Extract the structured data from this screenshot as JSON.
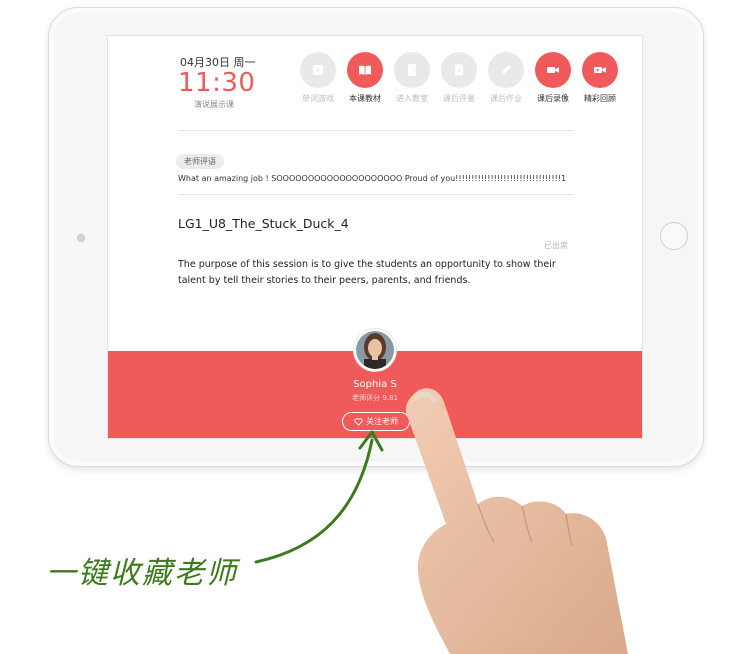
{
  "header": {
    "date": "04月30日 周一",
    "time": "11:30",
    "subtitle": "演说展示课"
  },
  "toolbar": [
    {
      "label": "单词游戏",
      "active": false,
      "icon": "game-icon"
    },
    {
      "label": "本课教材",
      "active": true,
      "icon": "book-icon"
    },
    {
      "label": "进入教室",
      "active": false,
      "icon": "door-icon"
    },
    {
      "label": "课后评量",
      "active": false,
      "icon": "checklist-icon"
    },
    {
      "label": "课后作业",
      "active": false,
      "icon": "pencil-icon"
    },
    {
      "label": "课后录像",
      "active": true,
      "icon": "video-icon"
    },
    {
      "label": "精彩回顾",
      "active": true,
      "icon": "replay-video-icon"
    }
  ],
  "evaluation": {
    "tag": "老师评语",
    "text": "What an amazing job ! SOOOOOOOOOOOOOOOOOOOO Proud of you!!!!!!!!!!!!!!!!!!!!!!!!!!!!!!!!!1"
  },
  "lesson": {
    "title": "LG1_U8_The_Stuck_Duck_4",
    "status": "已出席",
    "description": "The purpose of this session is to give the students an opportunity to show their talent by tell their stories to their peers, parents, and friends."
  },
  "teacher": {
    "name": "Sophia S",
    "rating": "老师评分 9.81",
    "follow_label": "关注老师"
  },
  "caption": "一键收藏老师",
  "colors": {
    "accent": "#f05a5b",
    "caption_green": "#3c7a1d"
  }
}
